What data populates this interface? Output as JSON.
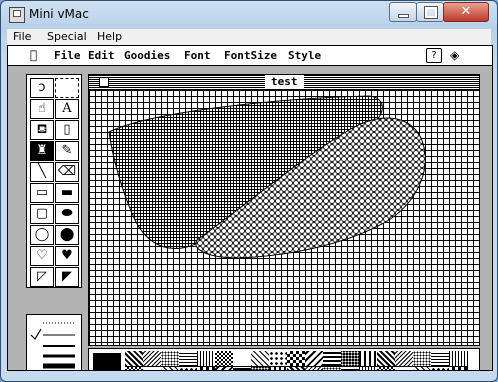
{
  "window": {
    "title": "Mini vMac"
  },
  "win_menu": [
    "File",
    "Special",
    "Help"
  ],
  "mac_menu": [
    "File",
    "Edit",
    "Goodies",
    "Font",
    "FontSize",
    "Style"
  ],
  "document": {
    "title": "test"
  },
  "icons": {
    "apple": "apple-icon",
    "help": "question-icon",
    "app": "macpaint-icon"
  },
  "colors": {
    "titlebar": "#b8d0ea",
    "close_button": "#c0392b",
    "screen_bg": "#ffffff",
    "ink": "#000000"
  }
}
